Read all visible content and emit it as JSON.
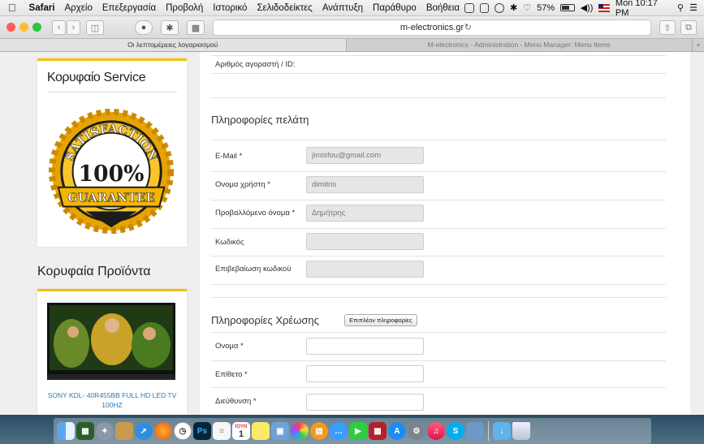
{
  "menubar": {
    "apple": "",
    "items": [
      "Safari",
      "Αρχείο",
      "Επεξεργασία",
      "Προβολή",
      "Ιστορικό",
      "Σελιδοδείκτες",
      "Ανάπτυξη",
      "Παράθυρο",
      "Βοήθεια"
    ],
    "battery": "57%",
    "clock": "Mon 10:17 PM"
  },
  "toolbar": {
    "url": "m-electronics.gr"
  },
  "tabs": [
    {
      "label": "Οι λεπτομέρειες λογαριασμού"
    },
    {
      "label": "M-electronics - Administration - Menu Manager: Menu Items"
    }
  ],
  "sidebar": {
    "service_title_bold": "Κορυφαίο",
    "service_title_rest": " Service",
    "badge": {
      "top": "SATISFACTION",
      "mid": "100%",
      "bottom": "GUARANTEE"
    },
    "products_title": "Κορυφαία Προϊόντα",
    "product_name": "SONY KDL- 40R455BB FULL HD LED TV 100HZ"
  },
  "form": {
    "buyer_id_label": "Αριθμός αγοραστή / ID:",
    "customer_section": "Πληροφορίες πελάτη",
    "email_label": "E-Mail *",
    "email_value": "jimisfou@gmail.com",
    "username_label": "Ονομα χρήστη *",
    "username_value": "dimitris",
    "displayname_label": "Προβαλλόμενο όνομα *",
    "displayname_value": "Δημήτρης",
    "password_label": "Κωδικός",
    "password_confirm_label": "Επιβεβαίωση κωδικού",
    "billing_section": "Πληροφορίες Χρέωσης",
    "more_info_button": "Επιπλέον πληροφορίες",
    "firstname_label": "Ονομα *",
    "lastname_label": "Επίθετο *",
    "address_label": "Διεύθυνση *"
  },
  "dock": {
    "icons": [
      "finder-icon",
      "mission-control-icon",
      "launchpad-icon",
      "photos-app-icon",
      "safari-icon",
      "firefox-icon",
      "clock-icon",
      "photoshop-icon",
      "notes-icon",
      "calendar-icon",
      "stickies-icon",
      "preview-icon",
      "photo-browser-icon",
      "ibooks-icon",
      "messages-icon",
      "facetime-icon",
      "photo-booth-icon",
      "app-store-icon",
      "system-preferences-icon",
      "itunes-icon",
      "skype-icon",
      "image-capture-icon",
      "downloads-folder-icon",
      "trash-icon"
    ],
    "calendar_month": "ΙΟΥΝ",
    "calendar_day": "1",
    "photoshop_text": "Ps",
    "skype_text": "S"
  },
  "colors": {
    "accent_yellow": "#f3c000",
    "link_blue": "#2a7ab8",
    "disabled_input": "#e6e6e6"
  }
}
